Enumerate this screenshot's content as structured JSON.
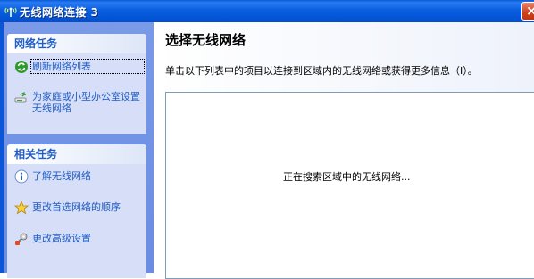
{
  "window": {
    "title": "无线网络连接 3",
    "icon": "wireless-signal-icon",
    "close_glyph": "×"
  },
  "taskpane": {
    "network_tasks": {
      "header": "网络任务",
      "items": [
        {
          "label": "刷新网络列表",
          "icon": "refresh-icon"
        },
        {
          "label": "为家庭或小型办公室设置无线网络",
          "icon": "setup-network-icon"
        }
      ]
    },
    "related_tasks": {
      "header": "相关任务",
      "items": [
        {
          "label": "了解无线网络",
          "icon": "info-icon"
        },
        {
          "label": "更改首选网络的顺序",
          "icon": "star-icon"
        },
        {
          "label": "更改高级设置",
          "icon": "settings-icon"
        }
      ]
    }
  },
  "main": {
    "title": "选择无线网络",
    "description": "单击以下列表中的项目以连接到区域内的无线网络或获得更多信息（I）。",
    "status": "正在搜索区域中的无线网络..."
  },
  "colors": {
    "titlebar": "#0a5ee0",
    "taskpane": "#6a8ce2",
    "link": "#215dc6"
  }
}
